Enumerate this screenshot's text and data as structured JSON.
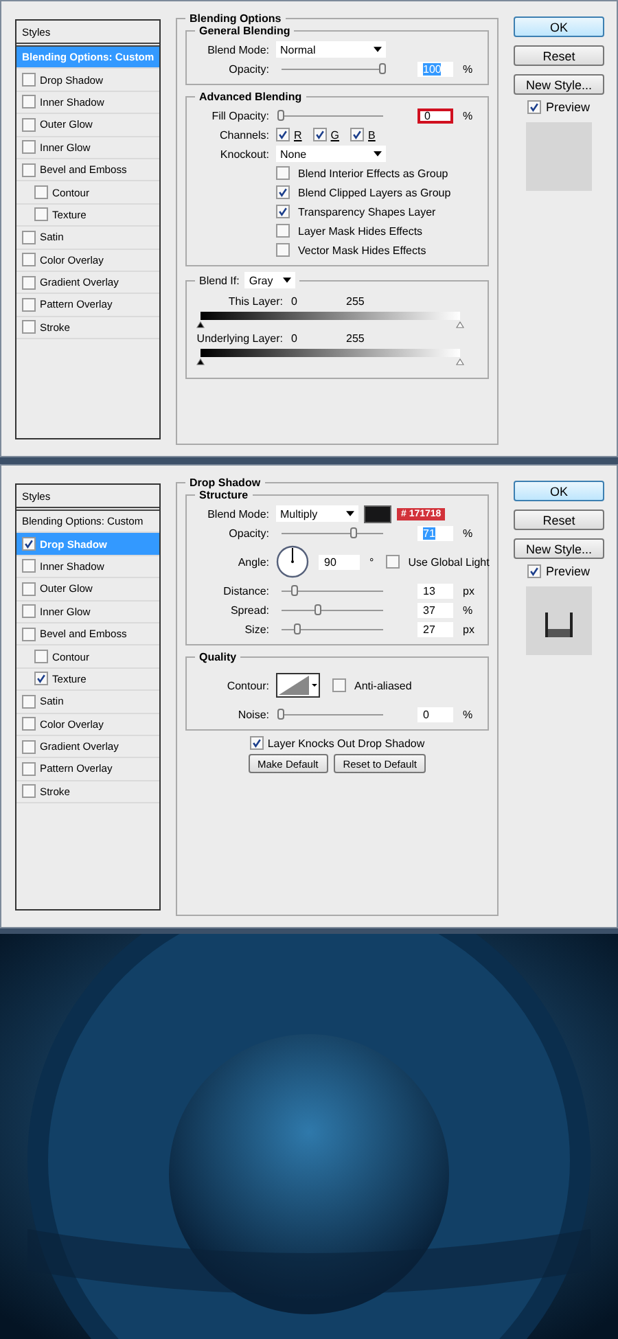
{
  "dialogs": [
    {
      "styles": [
        {
          "label": "Styles",
          "kind": "header",
          "selected": false
        },
        {
          "label": "Blending Options: Custom",
          "kind": "plain",
          "selected": true
        },
        {
          "label": "Drop Shadow",
          "kind": "check",
          "checked": false,
          "selected": false
        },
        {
          "label": "Inner Shadow",
          "kind": "check",
          "checked": false,
          "selected": false
        },
        {
          "label": "Outer Glow",
          "kind": "check",
          "checked": false,
          "selected": false
        },
        {
          "label": "Inner Glow",
          "kind": "check",
          "checked": false,
          "selected": false
        },
        {
          "label": "Bevel and Emboss",
          "kind": "check",
          "checked": false,
          "selected": false
        },
        {
          "label": "Contour",
          "kind": "subcheck",
          "checked": false,
          "selected": false
        },
        {
          "label": "Texture",
          "kind": "subcheck",
          "checked": false,
          "selected": false
        },
        {
          "label": "Satin",
          "kind": "check",
          "checked": false,
          "selected": false
        },
        {
          "label": "Color Overlay",
          "kind": "check",
          "checked": false,
          "selected": false
        },
        {
          "label": "Gradient Overlay",
          "kind": "check",
          "checked": false,
          "selected": false
        },
        {
          "label": "Pattern Overlay",
          "kind": "check",
          "checked": false,
          "selected": false
        },
        {
          "label": "Stroke",
          "kind": "check",
          "checked": false,
          "selected": false
        }
      ],
      "panel": {
        "title": "Blending Options",
        "sections": [
          {
            "kind": "group",
            "title": "General Blending",
            "rows": [
              {
                "kind": "select",
                "label": "Blend Mode:",
                "value": "Normal"
              },
              {
                "kind": "slider",
                "label": "Opacity:",
                "level": 1,
                "value": "100",
                "unit": "%",
                "value_selected": true,
                "highlighted": false
              }
            ]
          },
          {
            "kind": "group",
            "title": "Advanced Blending",
            "rows": [
              {
                "kind": "slider",
                "label": "Fill Opacity:",
                "level": 0,
                "value": "0",
                "unit": "%",
                "value_selected": false,
                "highlighted": true
              },
              {
                "kind": "channels",
                "label": "Channels:",
                "items": [
                  {
                    "label": "R",
                    "checked": true
                  },
                  {
                    "label": "G",
                    "checked": true
                  },
                  {
                    "label": "B",
                    "checked": true
                  }
                ]
              },
              {
                "kind": "select",
                "label": "Knockout:",
                "value": "None"
              },
              {
                "kind": "checkbox",
                "label": "Blend Interior Effects as Group",
                "checked": false
              },
              {
                "kind": "checkbox",
                "label": "Blend Clipped Layers as Group",
                "checked": true
              },
              {
                "kind": "checkbox",
                "label": "Transparency Shapes Layer",
                "checked": true
              },
              {
                "kind": "checkbox",
                "label": "Layer Mask Hides Effects",
                "checked": false
              },
              {
                "kind": "checkbox",
                "label": "Vector Mask Hides Effects",
                "checked": false
              }
            ]
          },
          {
            "kind": "blend_if",
            "title": "Blend If:",
            "value": "Gray",
            "rows": [
              {
                "kind": "gradient",
                "label": "This Layer:",
                "low": "0",
                "high": "255",
                "handles": [
                  {
                    "level": 0
                  },
                  {
                    "level": 1
                  }
                ]
              },
              {
                "kind": "gradient",
                "label": "Underlying Layer:",
                "low": "0",
                "high": "255",
                "handles": [
                  {
                    "level": 0
                  },
                  {
                    "level": 1
                  }
                ]
              }
            ]
          }
        ]
      },
      "buttons": [
        {
          "label": "OK",
          "default": true
        },
        {
          "label": "Reset",
          "default": false
        },
        {
          "label": "New Style...",
          "default": false
        }
      ],
      "preview": {
        "label": "Preview",
        "checked": true,
        "kind": "plain"
      }
    },
    {
      "styles": [
        {
          "label": "Styles",
          "kind": "header",
          "selected": false
        },
        {
          "label": "Blending Options: Custom",
          "kind": "plain",
          "selected": false
        },
        {
          "label": "Drop Shadow",
          "kind": "check",
          "checked": true,
          "selected": true
        },
        {
          "label": "Inner Shadow",
          "kind": "check",
          "checked": false,
          "selected": false
        },
        {
          "label": "Outer Glow",
          "kind": "check",
          "checked": false,
          "selected": false
        },
        {
          "label": "Inner Glow",
          "kind": "check",
          "checked": false,
          "selected": false
        },
        {
          "label": "Bevel and Emboss",
          "kind": "check",
          "checked": false,
          "selected": false
        },
        {
          "label": "Contour",
          "kind": "subcheck",
          "checked": false,
          "selected": false
        },
        {
          "label": "Texture",
          "kind": "subcheck",
          "checked": true,
          "selected": false
        },
        {
          "label": "Satin",
          "kind": "check",
          "checked": false,
          "selected": false
        },
        {
          "label": "Color Overlay",
          "kind": "check",
          "checked": false,
          "selected": false
        },
        {
          "label": "Gradient Overlay",
          "kind": "check",
          "checked": false,
          "selected": false
        },
        {
          "label": "Pattern Overlay",
          "kind": "check",
          "checked": false,
          "selected": false
        },
        {
          "label": "Stroke",
          "kind": "check",
          "checked": false,
          "selected": false
        }
      ],
      "panel": {
        "title": "Drop Shadow",
        "sections": [
          {
            "kind": "group",
            "title": "Structure",
            "rows": [
              {
                "kind": "select",
                "label": "Blend Mode:",
                "value": "Multiply",
                "color": "#171718",
                "tag": "# 171718"
              },
              {
                "kind": "slider",
                "label": "Opacity:",
                "level": 0.71,
                "value": "71",
                "unit": "%",
                "value_selected": true,
                "highlighted": false
              },
              {
                "kind": "angle",
                "label": "Angle:",
                "value": "90",
                "unit": "°",
                "checkbox": {
                  "label": "Use Global Light",
                  "checked": false
                }
              },
              {
                "kind": "slider",
                "label": "Distance:",
                "level": 0.13,
                "value": "13",
                "unit": "px",
                "value_selected": false,
                "highlighted": false
              },
              {
                "kind": "slider",
                "label": "Spread:",
                "level": 0.37,
                "value": "37",
                "unit": "%",
                "value_selected": false,
                "highlighted": false
              },
              {
                "kind": "slider",
                "label": "Size:",
                "level": 0.16,
                "value": "27",
                "unit": "px",
                "value_selected": false,
                "highlighted": false
              }
            ]
          },
          {
            "kind": "group",
            "title": "Quality",
            "rows": [
              {
                "kind": "contour",
                "label": "Contour:",
                "checkbox": {
                  "label": "Anti-aliased",
                  "checked": false
                }
              },
              {
                "kind": "slider",
                "label": "Noise:",
                "level": 0,
                "value": "0",
                "unit": "%",
                "value_selected": false,
                "highlighted": false
              }
            ]
          }
        ],
        "after": [
          {
            "kind": "checkbox",
            "label": "Layer Knocks Out Drop Shadow",
            "checked": true
          },
          {
            "kind": "buttons",
            "items": [
              "Make Default",
              "Reset to Default"
            ]
          }
        ]
      },
      "buttons": [
        {
          "label": "OK",
          "default": true
        },
        {
          "label": "Reset",
          "default": false
        },
        {
          "label": "New Style...",
          "default": false
        }
      ],
      "preview": {
        "label": "Preview",
        "checked": true,
        "kind": "shadow"
      }
    }
  ]
}
